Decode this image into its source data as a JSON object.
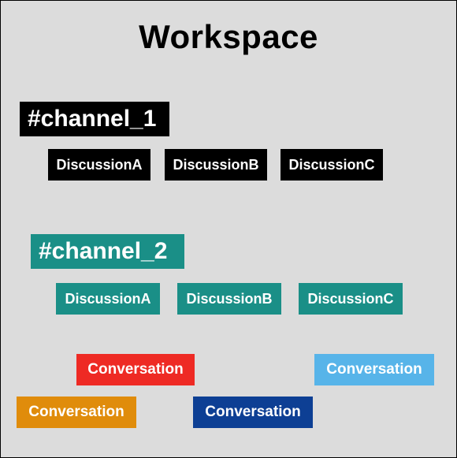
{
  "title": "Workspace",
  "channel1": {
    "label": "#channel_1",
    "discussions": {
      "a": "DiscussionA",
      "b": "DiscussionB",
      "c": "DiscussionC"
    }
  },
  "channel2": {
    "label": "#channel_2",
    "discussions": {
      "a": "DiscussionA",
      "b": "DiscussionB",
      "c": "DiscussionC"
    }
  },
  "conversations": {
    "red": "Conversation",
    "light": "Conversation",
    "orange": "Conversation",
    "navy": "Conversation"
  },
  "colors": {
    "channel1": "#000000",
    "channel2": "#1a8f87",
    "conv_red": "#ee2a24",
    "conv_light": "#57b4e9",
    "conv_orange": "#e08c0b",
    "conv_navy": "#0d3f94"
  }
}
